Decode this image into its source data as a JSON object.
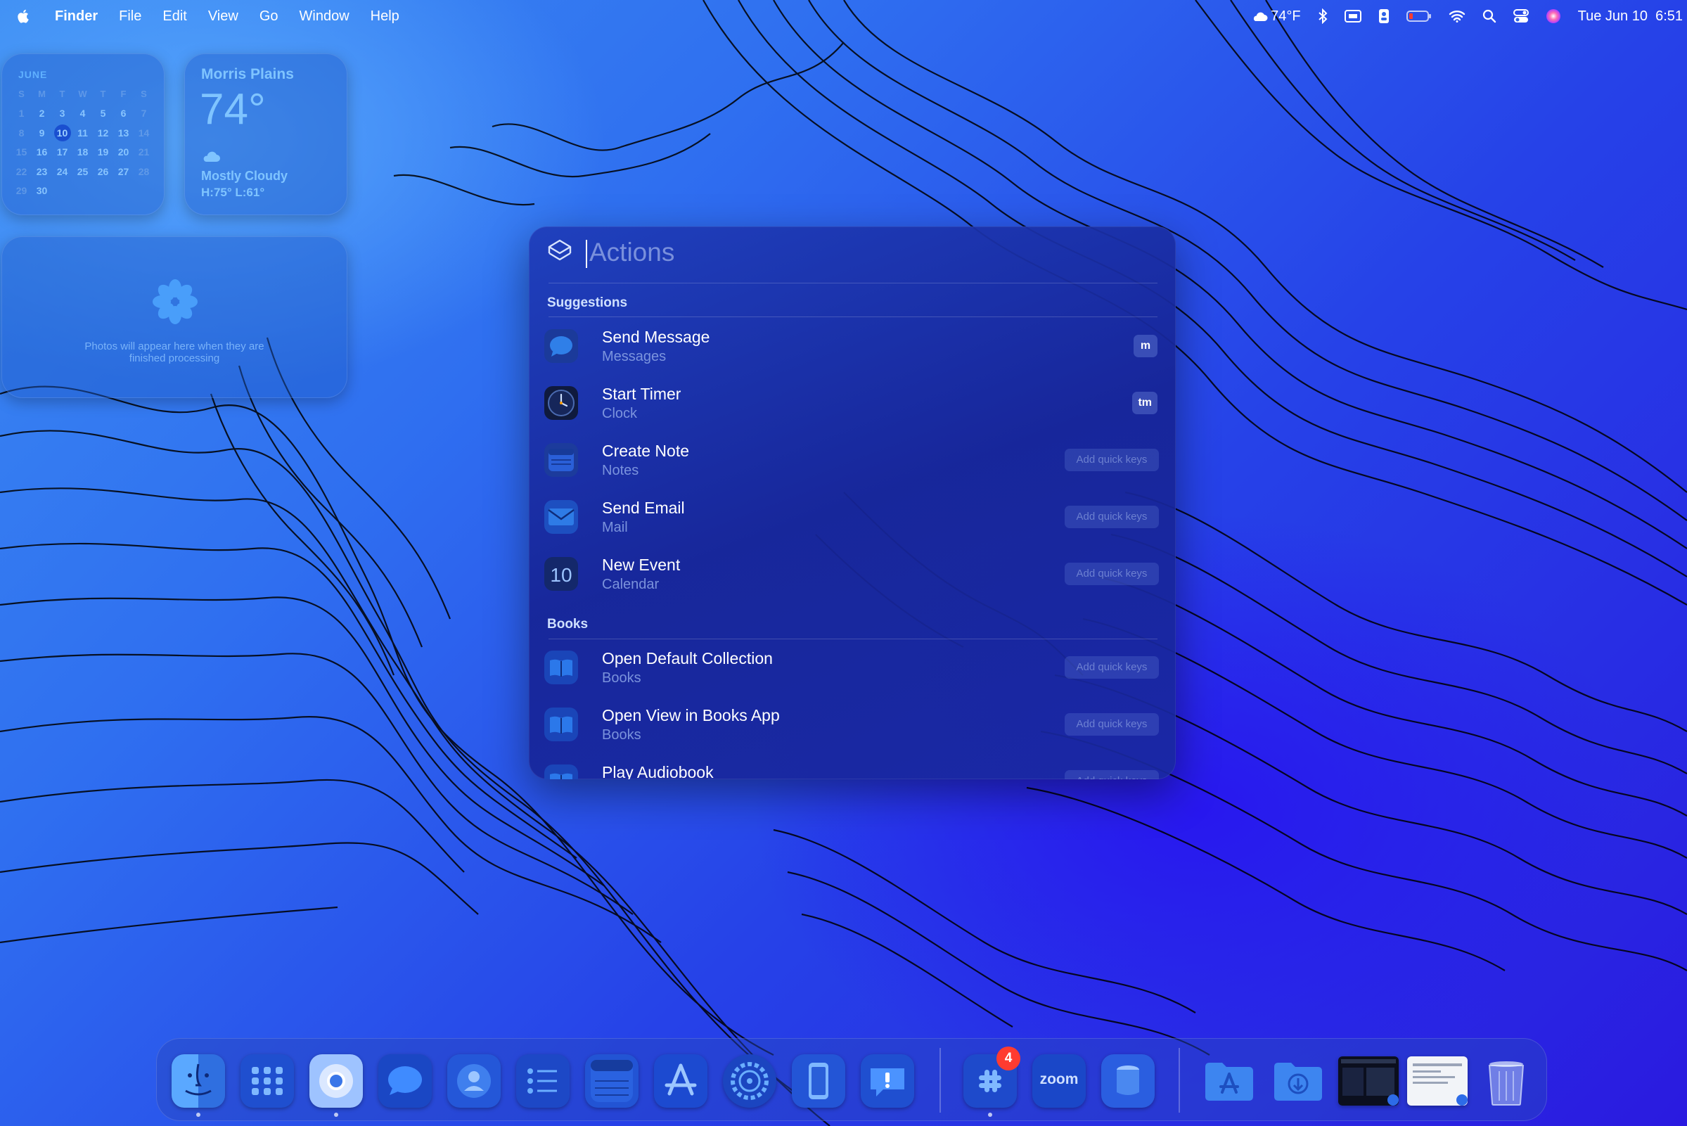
{
  "menubar": {
    "app_name": "Finder",
    "menus": [
      "File",
      "Edit",
      "View",
      "Go",
      "Window",
      "Help"
    ],
    "weather_status": "74°F",
    "datetime": "Tue Jun 10  6:51",
    "icons": [
      "apple-icon",
      "cloud-icon",
      "bluetooth-icon",
      "display-icon",
      "id-icon",
      "battery-icon",
      "wifi-icon",
      "spotlight-icon",
      "control-center-icon",
      "siri-icon"
    ]
  },
  "widgets": {
    "calendar": {
      "month": "JUNE",
      "weekdays": [
        "S",
        "M",
        "T",
        "W",
        "T",
        "F",
        "S"
      ],
      "weeks": [
        [
          "1",
          "2",
          "3",
          "4",
          "5",
          "6",
          "7"
        ],
        [
          "8",
          "9",
          "10",
          "11",
          "12",
          "13",
          "14"
        ],
        [
          "15",
          "16",
          "17",
          "18",
          "19",
          "20",
          "21"
        ],
        [
          "22",
          "23",
          "24",
          "25",
          "26",
          "27",
          "28"
        ],
        [
          "29",
          "30",
          "",
          "",
          "",
          "",
          ""
        ]
      ],
      "today": "10"
    },
    "weather": {
      "city": "Morris Plains",
      "temp": "74°",
      "condition": "Mostly Cloudy",
      "high_low": "H:75° L:61°"
    },
    "photos": {
      "message_line1": "Photos will appear here when they are",
      "message_line2": "finished processing"
    }
  },
  "spotlight": {
    "query_placeholder": "Actions",
    "sections": [
      {
        "label": "Suggestions",
        "items": [
          {
            "title": "Send Message",
            "subtitle": "Messages",
            "key": "m",
            "icon": "messages-icon",
            "color": "#2f7fe8"
          },
          {
            "title": "Start Timer",
            "subtitle": "Clock",
            "key": "tm",
            "icon": "clock-icon",
            "color": "#1b2a55"
          },
          {
            "title": "Create Note",
            "subtitle": "Notes",
            "key": "Add quick keys",
            "icon": "notes-icon",
            "color": "#2a5fd8"
          },
          {
            "title": "Send Email",
            "subtitle": "Mail",
            "key": "Add quick keys",
            "icon": "mail-icon",
            "color": "#2e7be6"
          },
          {
            "title": "New Event",
            "subtitle": "Calendar",
            "key": "Add quick keys",
            "icon": "calendar-icon",
            "color": "#1e3a8a",
            "icon_text": "10"
          }
        ]
      },
      {
        "label": "Books",
        "items": [
          {
            "title": "Open Default Collection",
            "subtitle": "Books",
            "key": "Add quick keys",
            "icon": "books-icon",
            "color": "#2b78ea"
          },
          {
            "title": "Open View in Books App",
            "subtitle": "Books",
            "key": "Add quick keys",
            "icon": "books-icon",
            "color": "#2b78ea"
          },
          {
            "title": "Play Audiobook",
            "subtitle": "",
            "key": "Add quick keys",
            "icon": "books-icon",
            "color": "#2b78ea"
          }
        ]
      }
    ]
  },
  "dock": {
    "apps": [
      {
        "name": "finder-icon"
      },
      {
        "name": "launchpad-icon"
      },
      {
        "name": "chrome-icon"
      },
      {
        "name": "messages-icon"
      },
      {
        "name": "contacts-icon"
      },
      {
        "name": "reminders-icon"
      },
      {
        "name": "notes-icon"
      },
      {
        "name": "app-store-icon"
      },
      {
        "name": "system-settings-icon"
      },
      {
        "name": "iphone-mirroring-icon"
      },
      {
        "name": "feedback-icon"
      },
      {
        "name": "slack-icon",
        "badge": "4"
      },
      {
        "name": "zoom-icon",
        "label": "zoom"
      },
      {
        "name": "app-icon"
      },
      {
        "name": "applications-folder-icon"
      },
      {
        "name": "downloads-folder-icon"
      },
      {
        "name": "screenshot-thumbnail-icon"
      },
      {
        "name": "document-thumbnail-icon"
      },
      {
        "name": "trash-icon"
      }
    ]
  }
}
